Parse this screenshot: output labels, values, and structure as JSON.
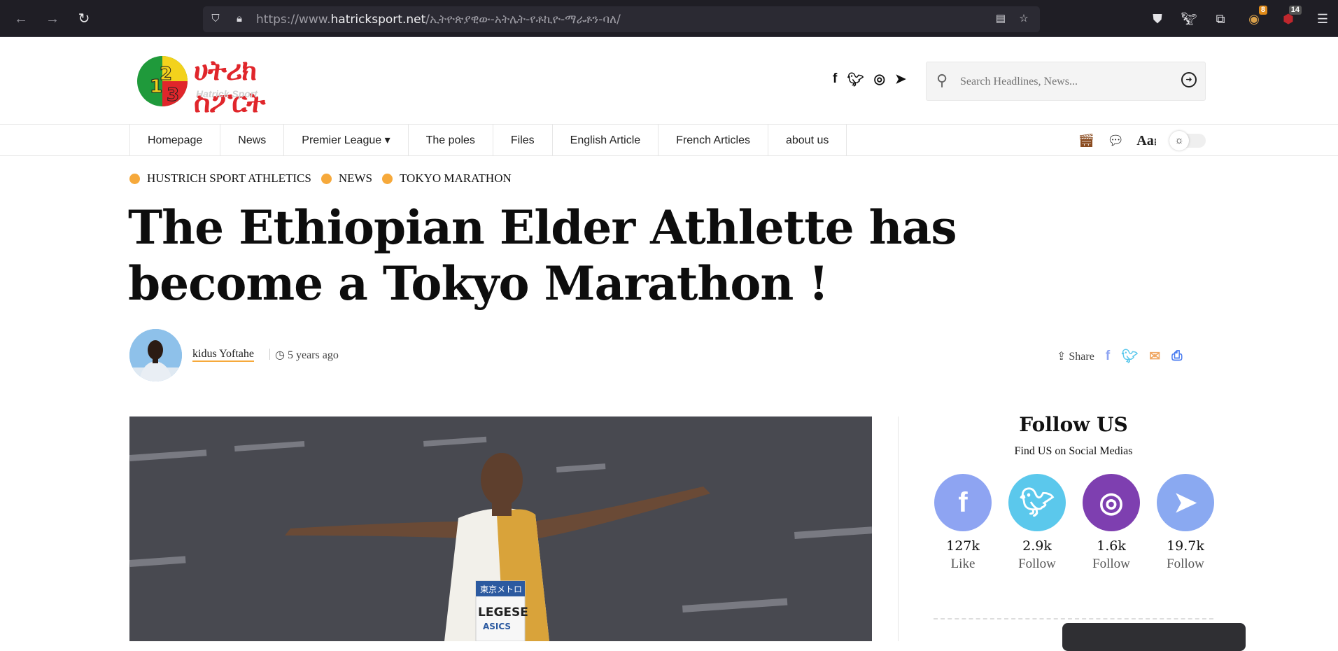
{
  "browser": {
    "url_prefix": "https://www.",
    "url_domain": "hatricksport.net",
    "url_path": "/ኢትዮጵያዊው-አትሌት-የቶኪዮ-ማራቶን-ባለ/",
    "badge_1": "8",
    "badge_2": "14"
  },
  "header": {
    "logo_amharic": "ሀትሪክ ስፖርት",
    "logo_english": "Hatrick Sport",
    "search_placeholder": "Search Headlines, News..."
  },
  "nav": {
    "items": [
      "Homepage",
      "News",
      "Premier League ▾",
      "The poles",
      "Files",
      "English Article",
      "French Articles",
      "about us"
    ],
    "font_label": "Aa"
  },
  "article": {
    "categories": [
      "HUSTRICH SPORT ATHLETICS",
      "NEWS",
      "TOKYO MARATHON"
    ],
    "title": "The Ethiopian Elder Athlette has become a Tokyo Marathon !",
    "author": "kidus Yoftahe",
    "time": "5 years ago",
    "share_label": "Share"
  },
  "sidebar": {
    "title": "Follow US",
    "subtitle": "Find US on Social Medias",
    "accounts": [
      {
        "network": "facebook",
        "count": "127k",
        "action": "Like",
        "color": "#8ea4f2"
      },
      {
        "network": "twitter",
        "count": "2.9k",
        "action": "Follow",
        "color": "#5bc8ec"
      },
      {
        "network": "instagram",
        "count": "1.6k",
        "action": "Follow",
        "color": "#7e3fb0"
      },
      {
        "network": "telegram",
        "count": "19.7k",
        "action": "Follow",
        "color": "#8aa9f1"
      }
    ]
  },
  "hero_bib": {
    "line1": "東京メトロ",
    "name": "LEGESE",
    "sponsor": "ASICS"
  }
}
